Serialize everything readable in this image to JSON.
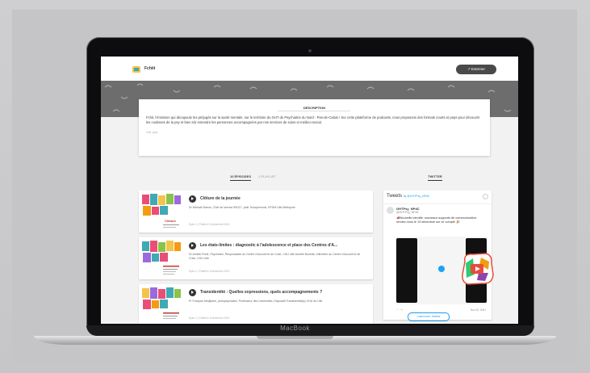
{
  "laptop": {
    "brand": "MacBook"
  },
  "site": {
    "name": "Fchiit",
    "external_button": "↗ Externer"
  },
  "description": {
    "title": "DESCRIPTION",
    "text": "Fchit, l'émission qui décapoule les préjugés sur la santé mentale, sur le territoire du GHT de Psychiatrie du Nord - Pas-de-Calais ! Sur cette plateforme de podcasts, nous proposons des formats courts et peps pour découvrir les coulisses de la psy et bien sûr entendre les personnes accompagnées par nos services de soins et médico-social.",
    "see_more": "Voir plus"
  },
  "tabs": {
    "episodes": "10 ÉPISODES",
    "playlist": "1 PLAYLIST"
  },
  "twitter_heading": "TWITTER",
  "episodes": [
    {
      "title": "Clôture de la journée",
      "subtitle": "Dr Michaël Hanon, Chef de service 59G17, pôle Tourquennois, EPSM Lille Métropole",
      "meta": "Epén 1 | Publié le 6 décembre 2021"
    },
    {
      "title": "Les états-limites : diagnostic à l'adolescence et place des Centres d'A...",
      "subtitle": "Dr Amélie Porte, Psychiatre, Responsable du Centre d'Accueil et de Crise, CHU Lille Aurélie Bunetta, Infirmière au Centre d'Accueil et de Crise, CHU Lille",
      "meta": "Epén 1 | Publié le 6 décembre 2021"
    },
    {
      "title": "Transidentité : Quelles expressions, quels accompagnements ?",
      "subtitle": "Pr François Medjkane, pédopsychiatre, Professeur des Universités, Dispositif Transidentité(s) CHU de Lille",
      "meta": "Epén 1 | Publié le 6 décembre 2021"
    }
  ],
  "twitter": {
    "heading": "Tweets",
    "by": "by @GHTPsy_NPdC",
    "name": "GHTPsy_NPdC",
    "handle": "@GHTPsy_NPdC",
    "text": "📣Nouvelle identité, nouveaux supports de communication: rendez-vous le 13 décembre sur ce compte 🎉",
    "date": "Nov 22, 2021",
    "actions": "♡  ↪",
    "load_more": "Load more Tweets"
  }
}
